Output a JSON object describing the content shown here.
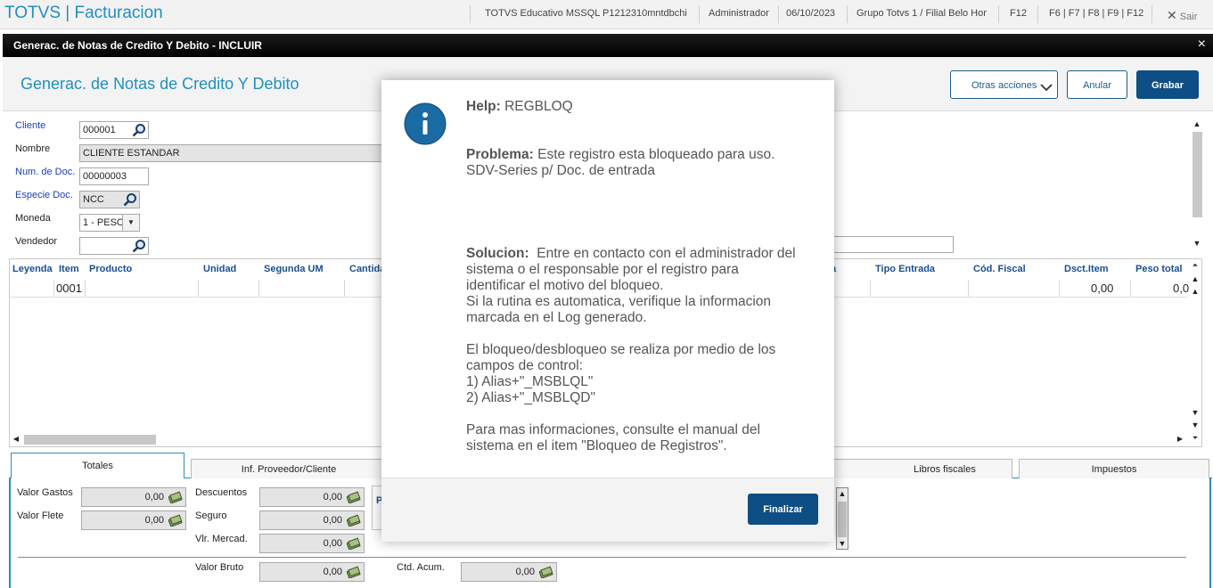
{
  "app": {
    "title": "TOTVS | Facturacion"
  },
  "topbar": {
    "environment": "TOTVS Educativo MSSQL P1212310mntdbchi",
    "user": "Administrador",
    "date": "06/10/2023",
    "branch": "Grupo Totvs 1 / Filial Belo Hor",
    "f12": "F12",
    "shortcuts": "F6 | F7 | F8 | F9 | F12",
    "exit": "Sair"
  },
  "window": {
    "title": "Generac. de Notas de Credito Y Debito - INCLUIR",
    "close": "×"
  },
  "form": {
    "title": "Generac. de Notas de Credito Y Debito",
    "actions": {
      "other": "Otras acciones",
      "cancel": "Anular",
      "save": "Grabar"
    },
    "fields": {
      "cliente": {
        "label": "Cliente",
        "value": "000001"
      },
      "nombre": {
        "label": "Nombre",
        "value": "CLIENTE ESTANDAR"
      },
      "num_doc": {
        "label": "Num. de Doc.",
        "value": "00000003"
      },
      "especie": {
        "label": "Especie Doc.",
        "value": "NCC"
      },
      "moneda": {
        "label": "Moneda",
        "value": "1 - PESO"
      },
      "vendedor": {
        "label": "Vendedor",
        "value": ""
      }
    }
  },
  "grid": {
    "columns": [
      "Leyenda",
      "Item",
      "Producto",
      "Unidad",
      "Segunda UM",
      "Cantida",
      "a",
      "Tipo Entrada",
      "Cód. Fiscal",
      "Dsct.Item",
      "Peso total"
    ],
    "row": {
      "item": "0001",
      "dsct": "0,00",
      "peso": "0,0"
    }
  },
  "tabs": [
    "Totales",
    "Inf. Proveedor/Cliente",
    "Libros fiscales",
    "Impuestos"
  ],
  "totals": {
    "valor_gastos": {
      "label": "Valor Gastos",
      "value": "0,00"
    },
    "valor_flete": {
      "label": "Valor Flete",
      "value": "0,00"
    },
    "descuentos": {
      "label": "Descuentos",
      "value": "0,00"
    },
    "seguro": {
      "label": "Seguro",
      "value": "0,00"
    },
    "vlr_mercad": {
      "label": "Vlr. Mercad.",
      "value": "0,00"
    },
    "valor_bruto": {
      "label": "Valor Bruto",
      "value": "0,00"
    },
    "ctd_acum": {
      "label": "Ctd. Acum.",
      "value": "0,00"
    },
    "partial": "P"
  },
  "modal": {
    "help_label": "Help:",
    "help_code": "REGBLOQ",
    "problem_label": "Problema:",
    "problem_line1": "Este registro esta bloqueado para uso.",
    "problem_line2": "SDV-Series p/ Doc. de entrada",
    "solution_label": "Solucion:",
    "solution_line1": "Entre en contacto con el administrador del",
    "solution_line2": "sistema o el responsable por el registro para",
    "solution_line3": "identificar el motivo del bloqueo.",
    "solution_line4": "Si la rutina es automatica, verifique la informacion",
    "solution_line5": "marcada en el Log generado.",
    "block_line1": "El bloqueo/desbloqueo se realiza por medio de los",
    "block_line2": "campos de control:",
    "block_line3": "1) Alias+\"_MSBLQL\"",
    "block_line4": "2) Alias+\"_MSBLQD\"",
    "more_line1": "Para mas informaciones, consulte el manual del",
    "more_line2": "sistema en el item \"Bloqueo de Registros\".",
    "finish": "Finalizar"
  },
  "colors": {
    "accent": "#1f8fbf",
    "primary_button": "#0d4e84",
    "info_icon": "#1a6aa4"
  }
}
